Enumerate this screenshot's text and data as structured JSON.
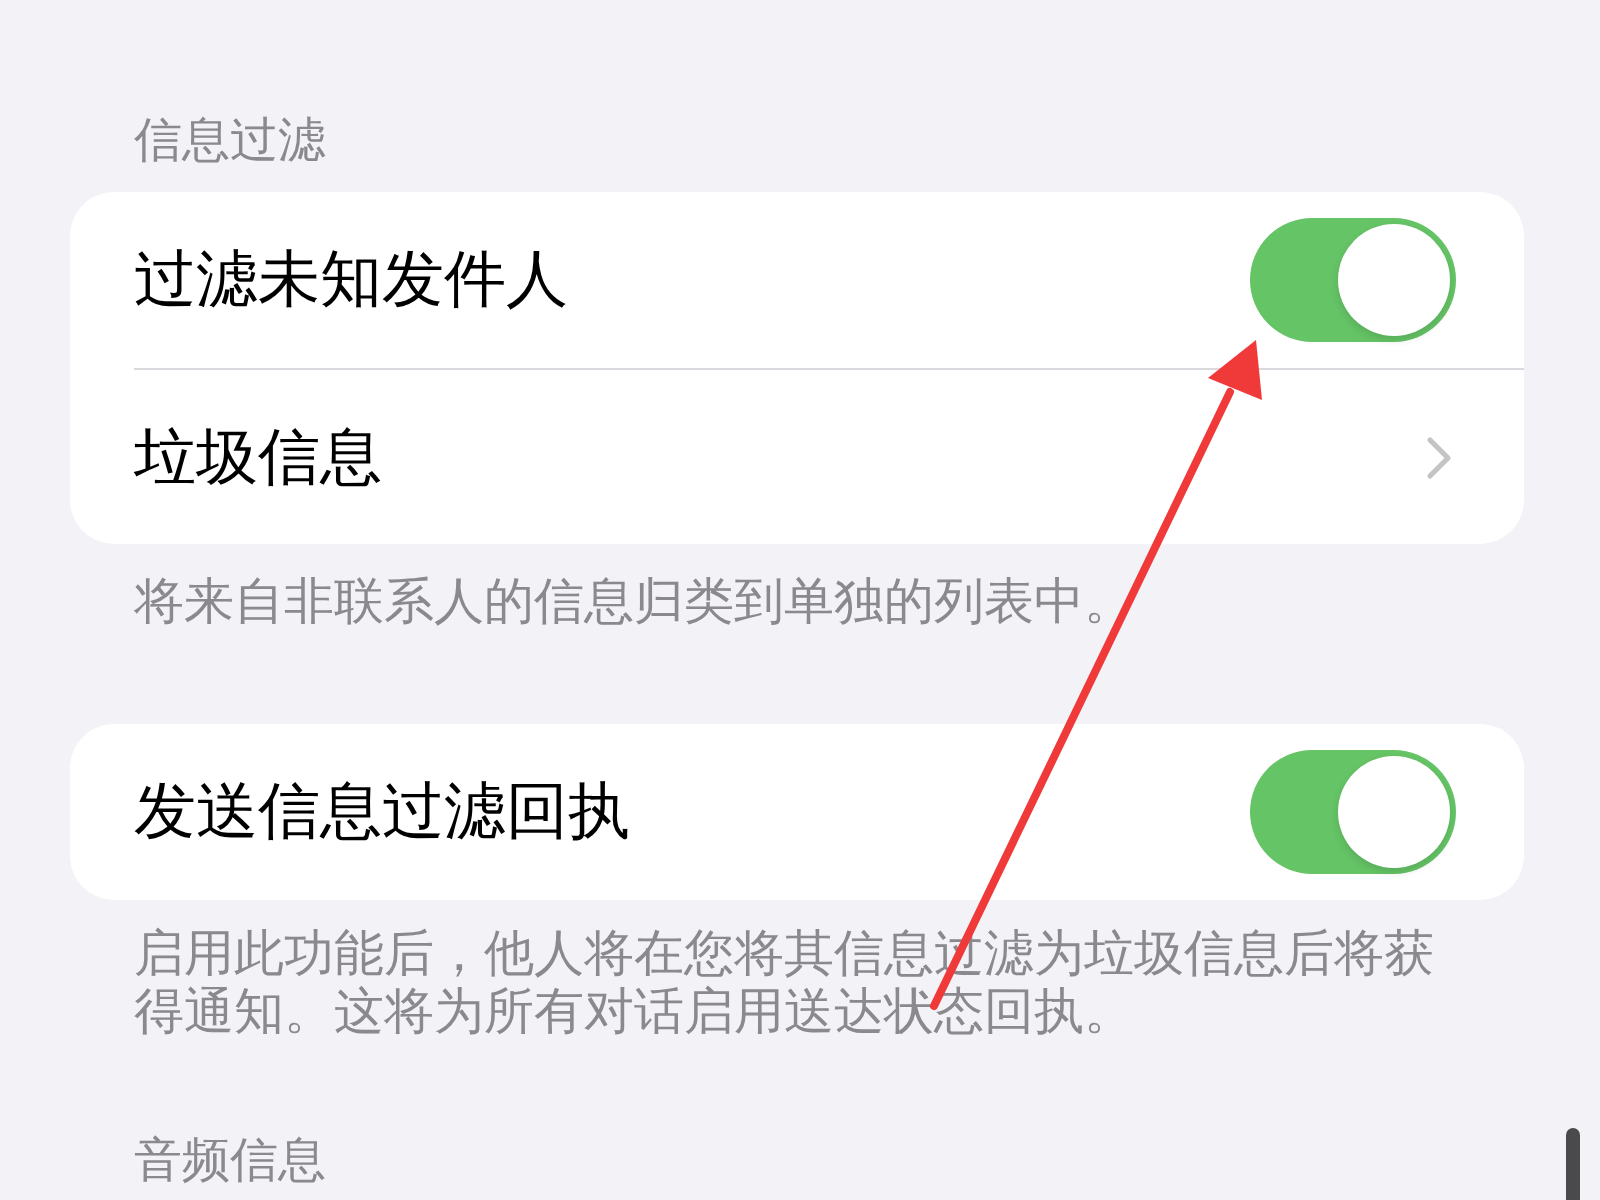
{
  "sections": [
    {
      "header": "信息过滤",
      "rows": [
        {
          "kind": "toggle",
          "label": "过滤未知发件人",
          "on": true
        },
        {
          "kind": "link",
          "label": "垃圾信息"
        }
      ],
      "footer": "将来自非联系人的信息归类到单独的列表中。"
    },
    {
      "rows": [
        {
          "kind": "toggle",
          "label": "发送信息过滤回执",
          "on": true
        }
      ],
      "footer": "启用此功能后，他人将在您将其信息过滤为垃圾信息后将获得通知。这将为所有对话启用送达状态回执。"
    },
    {
      "header": "音频信息"
    }
  ]
}
